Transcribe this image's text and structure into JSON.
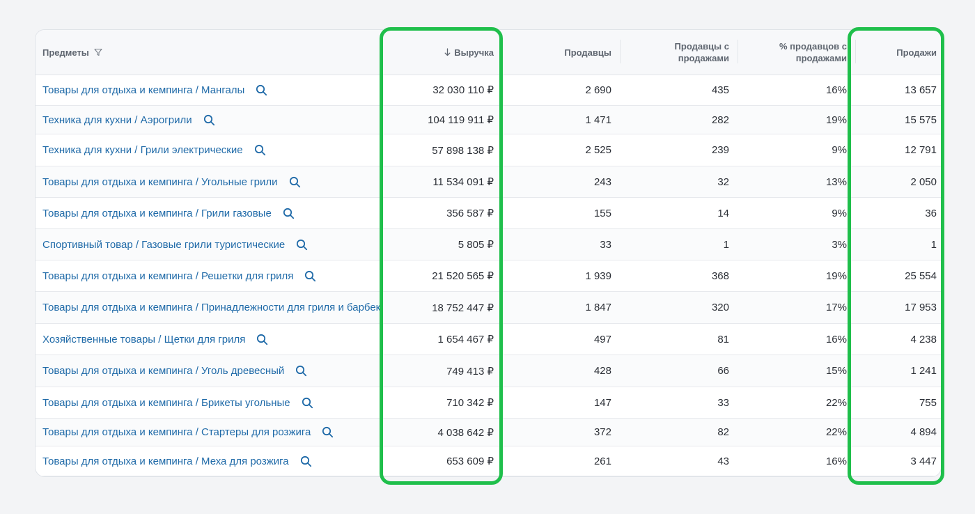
{
  "columns": {
    "subject": "Предметы",
    "revenue": "Выручка",
    "sellers": "Продавцы",
    "sellers_with_sales_line1": "Продавцы с",
    "sellers_with_sales_line2": "продажами",
    "pct_sellers_line1": "% продавцов с",
    "pct_sellers_line2": "продажами",
    "sales": "Продажи"
  },
  "sort": {
    "column": "revenue",
    "direction": "descending",
    "icon": "arrow-down-icon"
  },
  "icons": {
    "filter": "filter-funnel-icon",
    "search": "search-icon"
  },
  "colors": {
    "link": "#1f6aa8",
    "highlight": "#1fbf4b",
    "header_text": "#5f6670"
  },
  "rows": [
    {
      "subject": "Товары для отдыха и кемпинга / Мангалы",
      "revenue": "32 030 110 ₽",
      "sellers": "2 690",
      "sellers_with_sales": "435",
      "pct": "16%",
      "sales": "13 657"
    },
    {
      "subject": "Техника для кухни / Аэрогрили",
      "revenue": "104 119 911 ₽",
      "sellers": "1 471",
      "sellers_with_sales": "282",
      "pct": "19%",
      "sales": "15 575"
    },
    {
      "subject": "Техника для кухни / Грили электрические",
      "revenue": "57 898 138 ₽",
      "sellers": "2 525",
      "sellers_with_sales": "239",
      "pct": "9%",
      "sales": "12 791"
    },
    {
      "subject": "Товары для отдыха и кемпинга / Угольные грили",
      "revenue": "11 534 091 ₽",
      "sellers": "243",
      "sellers_with_sales": "32",
      "pct": "13%",
      "sales": "2 050"
    },
    {
      "subject": "Товары для отдыха и кемпинга / Грили газовые",
      "revenue": "356 587 ₽",
      "sellers": "155",
      "sellers_with_sales": "14",
      "pct": "9%",
      "sales": "36"
    },
    {
      "subject": "Спортивный товар / Газовые грили туристические",
      "revenue": "5 805 ₽",
      "sellers": "33",
      "sellers_with_sales": "1",
      "pct": "3%",
      "sales": "1"
    },
    {
      "subject": "Товары для отдыха и кемпинга / Решетки для гриля",
      "revenue": "21 520 565 ₽",
      "sellers": "1 939",
      "sellers_with_sales": "368",
      "pct": "19%",
      "sales": "25 554"
    },
    {
      "subject": "Товары для отдыха и кемпинга / Принадлежности для гриля и барбекю",
      "revenue": "18 752 447 ₽",
      "sellers": "1 847",
      "sellers_with_sales": "320",
      "pct": "17%",
      "sales": "17 953"
    },
    {
      "subject": "Хозяйственные товары / Щетки для гриля",
      "revenue": "1 654 467 ₽",
      "sellers": "497",
      "sellers_with_sales": "81",
      "pct": "16%",
      "sales": "4 238"
    },
    {
      "subject": "Товары для отдыха и кемпинга / Уголь древесный",
      "revenue": "749 413 ₽",
      "sellers": "428",
      "sellers_with_sales": "66",
      "pct": "15%",
      "sales": "1 241"
    },
    {
      "subject": "Товары для отдыха и кемпинга / Брикеты угольные",
      "revenue": "710 342 ₽",
      "sellers": "147",
      "sellers_with_sales": "33",
      "pct": "22%",
      "sales": "755"
    },
    {
      "subject": "Товары для отдыха и кемпинга / Стартеры для розжига",
      "revenue": "4 038 642 ₽",
      "sellers": "372",
      "sellers_with_sales": "82",
      "pct": "22%",
      "sales": "4 894"
    },
    {
      "subject": "Товары для отдыха и кемпинга / Меха для розжига",
      "revenue": "653 609 ₽",
      "sellers": "261",
      "sellers_with_sales": "43",
      "pct": "16%",
      "sales": "3 447"
    }
  ]
}
